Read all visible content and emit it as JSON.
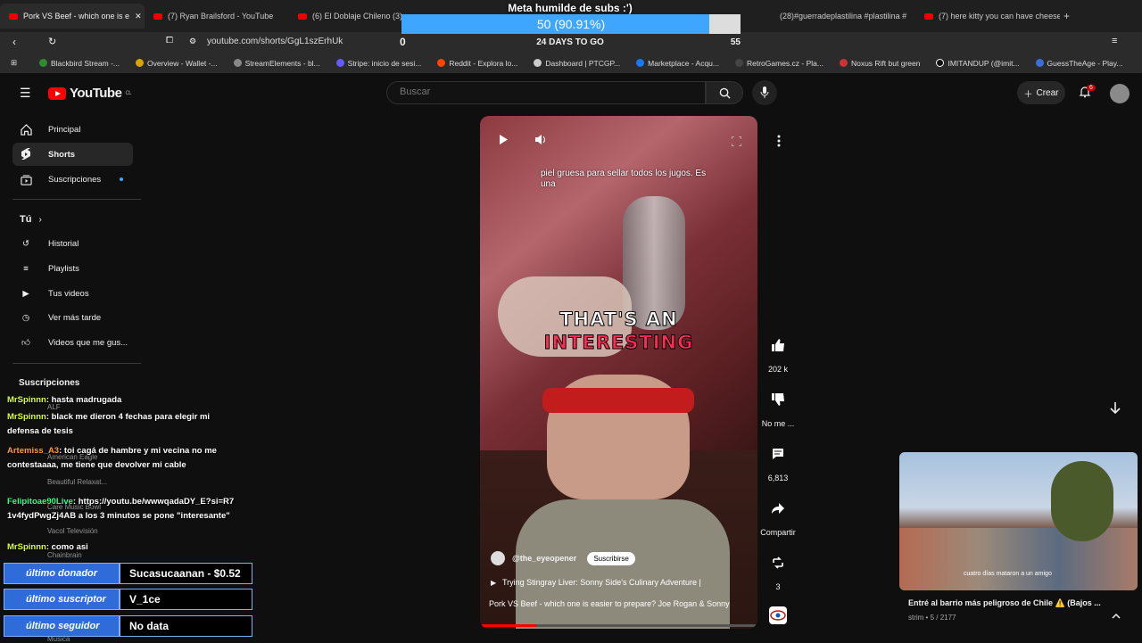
{
  "browser": {
    "tabs": [
      {
        "title": "Pork VS Beef - which one is e"
      },
      {
        "title": "(7) Ryan Brailsford - YouTube"
      },
      {
        "title": "(6) El Doblaje Chileno (3):"
      },
      {
        "title": "(28)#guerradeplastilina #plastilina #"
      },
      {
        "title": "(7) here kitty you can have cheese b"
      }
    ],
    "url": "youtube.com/shorts/GgL1szErhUk",
    "bookmarks": [
      "Blackbird Stream -...",
      "Overview - Wallet -...",
      "StreamElements - bl...",
      "Stripe: inicio de sesi...",
      "Reddit - Explora lo...",
      "Dashboard | PTCGP...",
      "Marketplace - Acqu...",
      "RetroGames.cz - Pla...",
      "Noxus Rift but green",
      "IMITANDUP (@imit...",
      "GuessTheAge - Play..."
    ]
  },
  "goal": {
    "title": "Meta humilde de subs :')",
    "bar_text": "50 (90.91%)",
    "progress_fraction": 0.9091,
    "start": "0",
    "days": "24 DAYS TO GO",
    "target": "55"
  },
  "header": {
    "logo": "YouTube",
    "region": "CL",
    "search_placeholder": "Buscar",
    "create_label": "Crear",
    "notif_count": "6"
  },
  "sidebar": {
    "items": [
      {
        "label": "Principal"
      },
      {
        "label": "Shorts"
      },
      {
        "label": "Suscripciones"
      }
    ],
    "you_label": "Tú",
    "you_items": [
      {
        "label": "Historial"
      },
      {
        "label": "Playlists"
      },
      {
        "label": "Tus videos"
      },
      {
        "label": "Ver más tarde"
      },
      {
        "label": "Videos que me gus..."
      }
    ],
    "subs_label": "Suscripciones"
  },
  "video": {
    "subtitle_top": "piel gruesa para sellar todos los jugos. Es una",
    "caption_line1": "THAT'S AN",
    "caption_line2": "INTERESTING",
    "channel": "@the_eyeopener",
    "subscribe": "Suscribirse",
    "related": "Trying Stingray Liver: Sonny Side's Culinary Adventure |",
    "title": "Pork VS Beef - which one is easier to prepare? Joe Rogan & Sonny",
    "progress_fraction": 0.2
  },
  "actions": {
    "likes": "202 k",
    "dislike": "No me ...",
    "comments": "6,813",
    "share": "Compartir",
    "remix": "3"
  },
  "next": {
    "title": "Entré al barrio más peligroso de Chile ⚠️ (Bajos ...",
    "meta": "strim • 5 / 2177",
    "thumb_caption": "cuatro días mataron a un amigo"
  },
  "chat": {
    "messages": [
      {
        "user": "MrSpinnn",
        "text": ": hasta madrugada"
      },
      {
        "user": "MrSpinnn",
        "text": ": black me dieron 4 fechas para elegir mi defensa de tesis"
      },
      {
        "user": "Artemiss_A3",
        "text": ": toi cagá de hambre y mi vecina no me contestaaaa, me tiene que devolver mi cable"
      },
      {
        "user": "Felipitoae90Live",
        "text": ": https://youtu.be/wwwqadaDY_E?si=R71v4fydPwgZj4AB a los 3 minutos se pone \"interesante\""
      },
      {
        "user": "MrSpinnn",
        "text": ": como asi"
      }
    ],
    "ghost": [
      "ALF",
      "American Eagle",
      "Beautiful Relaxat...",
      "Care Music Bowl",
      "Vacol Televisión",
      "Chainbrain",
      "Música"
    ]
  },
  "overlay": {
    "donor_label": "último donador",
    "donor_value": "Sucasucaanan - $0.52",
    "sub_label": "último suscriptor",
    "sub_value": "V_1ce",
    "follower_label": "último seguidor",
    "follower_value": "No data"
  }
}
